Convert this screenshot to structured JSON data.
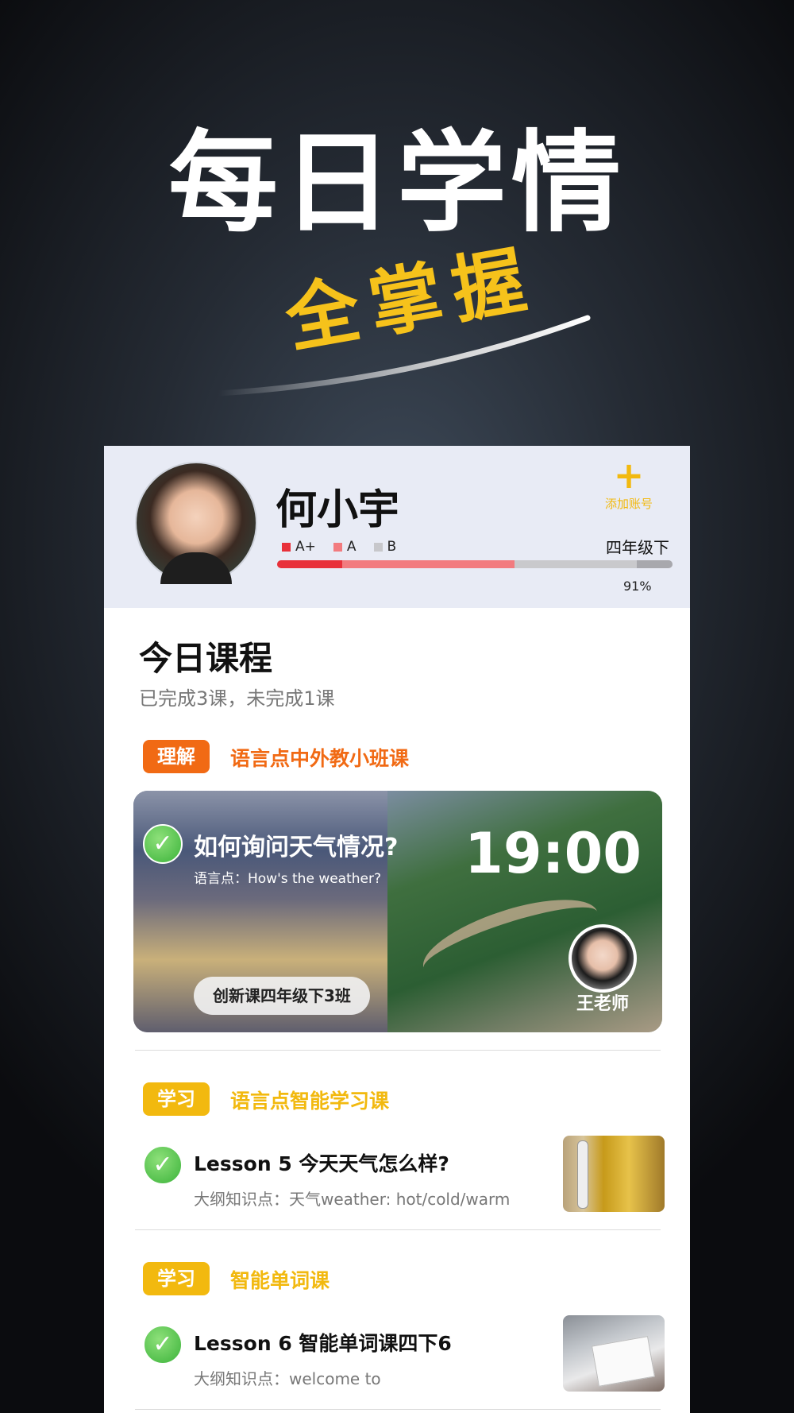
{
  "hero": {
    "title": "每日学情",
    "slogan": "全掌握"
  },
  "profile": {
    "name": "何小宇",
    "add_account_label": "添加账号",
    "add_account_icon": "plus-icon",
    "grade": "四年级下",
    "legend": [
      {
        "label": "A+",
        "color": "#e8303a"
      },
      {
        "label": "A",
        "color": "#f27b7f"
      },
      {
        "label": "B",
        "color": "#c7c7cb"
      }
    ],
    "progress_segments": [
      {
        "label": "A+",
        "fraction": 0.165,
        "color": "#e8303a"
      },
      {
        "label": "A",
        "fraction": 0.435,
        "color": "#f27b7f"
      },
      {
        "label": "B",
        "fraction": 0.31,
        "color": "#c9c9cc"
      },
      {
        "label": "rest",
        "fraction": 0.09,
        "color": "#a8a8ad"
      }
    ],
    "percent": "91%"
  },
  "today": {
    "title": "今日课程",
    "summary": "已完成3课，未完成1课"
  },
  "course1": {
    "tag": "理解",
    "tag_color": "#f16a14",
    "type": "语言点中外教小班课",
    "type_color": "#f16a14",
    "title": "如何询问天气情况?",
    "subtitle": "语言点：How's the weather?",
    "time": "19:00",
    "class_name": "创新课四年级下3班",
    "teacher": "王老师",
    "done_icon": "check-circle-icon"
  },
  "course2": {
    "tag": "学习",
    "tag_color": "#f2b90f",
    "type": "语言点智能学习课",
    "type_color": "#f2b90f",
    "title": "Lesson 5 今天天气怎么样?",
    "subtitle": "大纲知识点：天气weather: hot/cold/warm"
  },
  "course3": {
    "tag": "学习",
    "tag_color": "#f2b90f",
    "type": "智能单词课",
    "type_color": "#f2b90f",
    "title": "Lesson 6 智能单词课四下6",
    "subtitle": "大纲知识点：welcome to"
  }
}
